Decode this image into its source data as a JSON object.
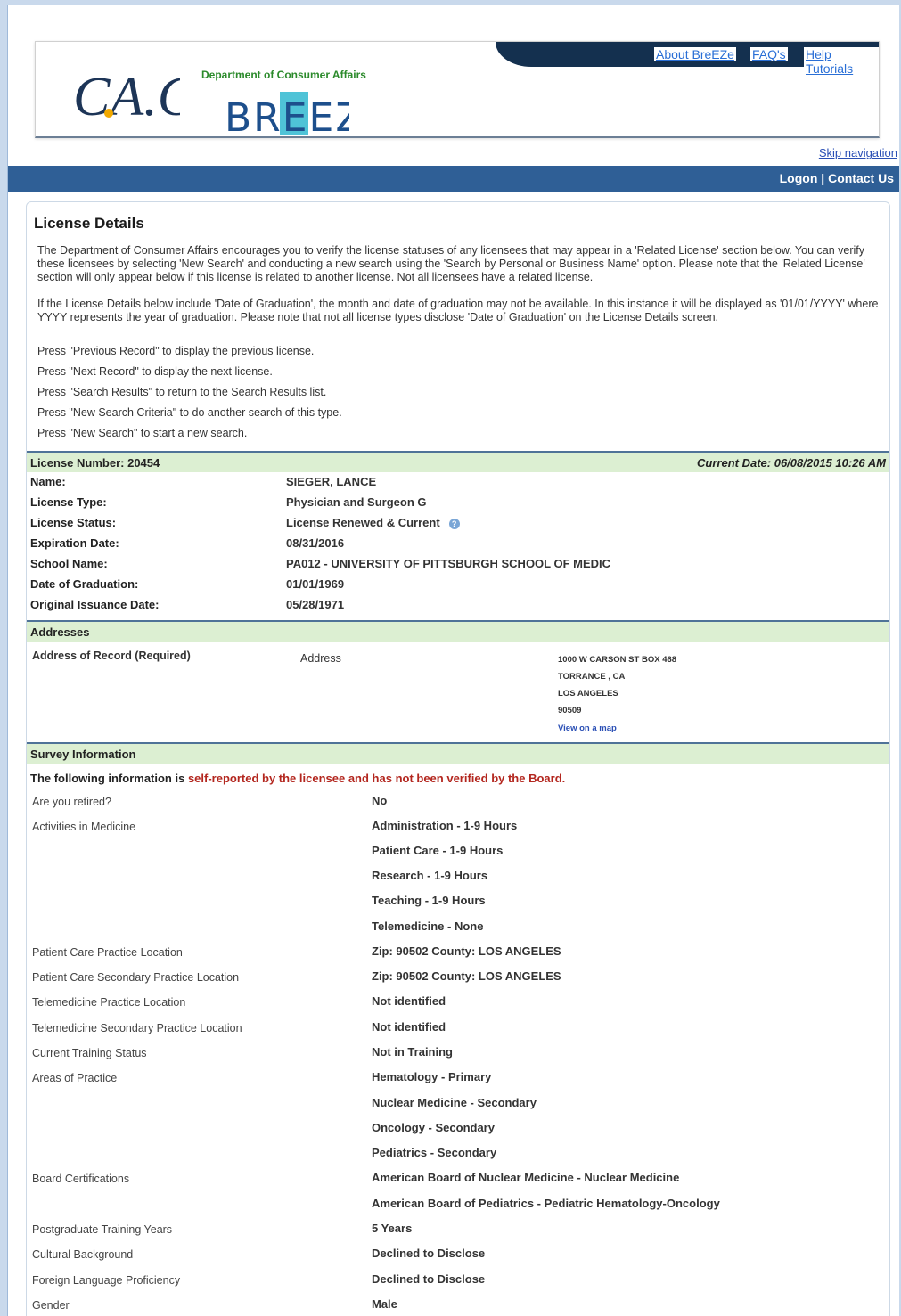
{
  "header": {
    "nav": [
      "About BreEZe",
      "FAQ's",
      "Help Tutorials"
    ],
    "dca_label": "Department of Consumer Affairs",
    "breeze_label": "BREEZE",
    "ca_logo_text": "CA.GOV",
    "skip_navigation": "Skip navigation",
    "logon": "Logon",
    "separator": "|",
    "contact_us": "Contact Us"
  },
  "page_title": "License Details",
  "intro": [
    "The Department of Consumer Affairs encourages you to verify the license statuses of any licensees that may appear in a 'Related License' section below. You can verify these licensees by selecting 'New Search' and conducting a new search using the 'Search by Personal or Business Name' option. Please note that the 'Related License' section will only appear below if this license is related to another license. Not all licensees have a related license.",
    "If the License Details below include 'Date of Graduation', the month and date of graduation may not be available. In this instance it will be displayed as '01/01/YYYY' where YYYY represents the year of graduation. Please note that not all license types disclose 'Date of Graduation' on the License Details screen."
  ],
  "instructions": [
    "Press \"Previous Record\" to display the previous license.",
    "Press \"Next Record\" to display the next license.",
    "Press \"Search Results\" to return to the Search Results list.",
    "Press \"New Search Criteria\" to do another search of this type.",
    "Press \"New Search\" to start a new search."
  ],
  "license": {
    "number_label": "License Number: 20454",
    "current_date": "Current Date: 06/08/2015 10:26 AM",
    "fields": [
      {
        "label": "Name:",
        "value": "SIEGER, LANCE"
      },
      {
        "label": "License Type:",
        "value": "Physician and Surgeon G"
      },
      {
        "label": "License Status:",
        "value": "License Renewed & Current"
      },
      {
        "label": "Expiration Date:",
        "value": "08/31/2016"
      },
      {
        "label": "School Name:",
        "value": "PA012 - UNIVERSITY OF PITTSBURGH SCHOOL OF MEDIC"
      },
      {
        "label": "Date of Graduation:",
        "value": "01/01/1969"
      },
      {
        "label": "Original Issuance Date:",
        "value": "05/28/1971"
      }
    ],
    "help_icon": "question-icon"
  },
  "addresses": {
    "title": "Addresses",
    "label": "Address of Record (Required)",
    "type": "Address",
    "lines": [
      "1000 W CARSON ST BOX 468",
      "TORRANCE , CA",
      "LOS ANGELES",
      "90509"
    ],
    "map_link": "View on a map"
  },
  "survey": {
    "title": "Survey Information",
    "note_prefix": "The following information is ",
    "note_red": "self-reported by the licensee and has not been verified by the Board.",
    "items": [
      {
        "label": "Are you retired?",
        "values": [
          "No"
        ]
      },
      {
        "label": "Activities in Medicine",
        "values": [
          "Administration - 1-9 Hours",
          "Patient Care - 1-9 Hours",
          "Research - 1-9 Hours",
          "Teaching - 1-9 Hours",
          "Telemedicine - None"
        ]
      },
      {
        "label": "Patient Care Practice Location",
        "values": [
          "Zip: 90502 County: LOS ANGELES"
        ]
      },
      {
        "label": "Patient Care Secondary Practice Location",
        "values": [
          "Zip: 90502 County: LOS ANGELES"
        ]
      },
      {
        "label": "Telemedicine Practice Location",
        "values": [
          "Not identified"
        ]
      },
      {
        "label": "Telemedicine Secondary Practice Location",
        "values": [
          "Not identified"
        ]
      },
      {
        "label": "Current Training Status",
        "values": [
          "Not in Training"
        ]
      },
      {
        "label": "Areas of Practice",
        "values": [
          "Hematology - Primary",
          "Nuclear Medicine - Secondary",
          "Oncology - Secondary",
          "Pediatrics - Secondary"
        ]
      },
      {
        "label": "Board Certifications",
        "values": [
          "American Board of Nuclear Medicine - Nuclear Medicine",
          "American Board of Pediatrics - Pediatric Hematology-Oncology"
        ]
      },
      {
        "label": "Postgraduate Training Years",
        "values": [
          "5 Years"
        ]
      },
      {
        "label": "Cultural Background",
        "values": [
          "Declined to Disclose"
        ]
      },
      {
        "label": "Foreign Language Proficiency",
        "values": [
          "Declined to Disclose"
        ]
      },
      {
        "label": "Gender",
        "values": [
          "Male"
        ]
      }
    ]
  },
  "colors": {
    "nav_dark": "#14304f",
    "bluebar": "#2f5f96",
    "section_green": "#dcefd2",
    "link": "#2a4fb5",
    "warning_red": "#b3261e"
  }
}
